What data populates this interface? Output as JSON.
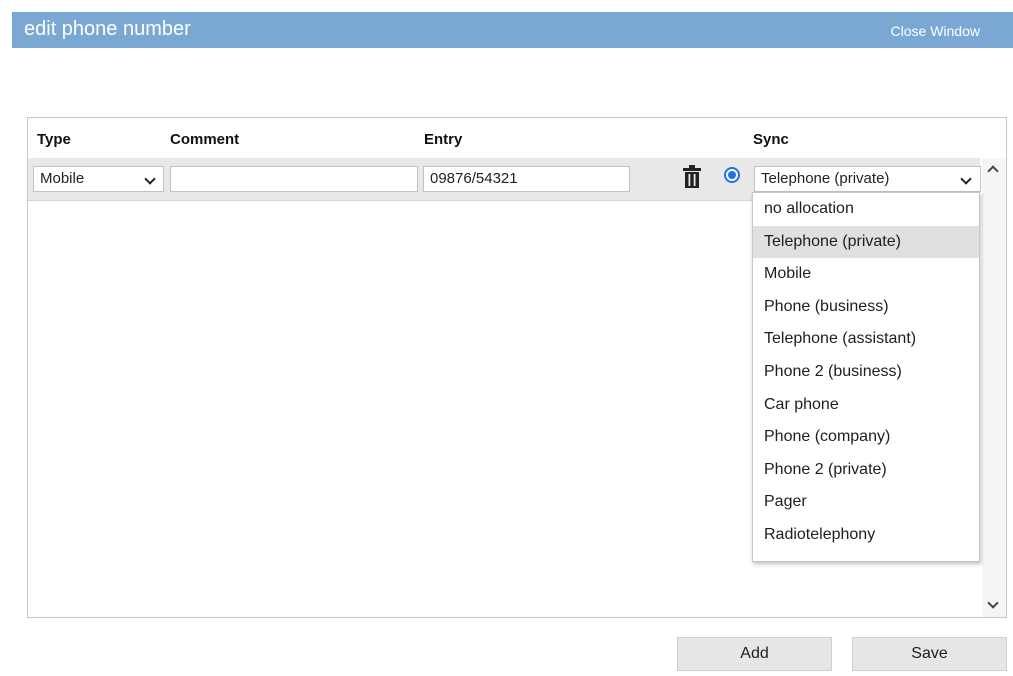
{
  "window": {
    "title": "edit phone number",
    "close_label": "Close Window"
  },
  "table": {
    "headers": {
      "type": "Type",
      "comment": "Comment",
      "entry": "Entry",
      "sync": "Sync"
    },
    "row": {
      "type_value": "Mobile",
      "comment_value": "",
      "entry_value": "09876/54321",
      "sync_value": "Telephone (private)",
      "primary_selected": true
    }
  },
  "sync_options": [
    "no allocation",
    "Telephone (private)",
    "Mobile",
    "Phone (business)",
    "Telephone (assistant)",
    "Phone 2 (business)",
    "Car phone",
    "Phone (company)",
    "Phone 2 (private)",
    "Pager",
    "Radiotelephony"
  ],
  "sync_selected_index": 1,
  "buttons": {
    "add": "Add",
    "save": "Save"
  },
  "icons": {
    "delete": "trash-icon",
    "primary": "radio-selected-icon",
    "dropdown": "chevron-down-icon",
    "scroll_up": "chevron-up-icon",
    "scroll_down": "chevron-down-icon"
  },
  "colors": {
    "titlebar": "#7ba7d3",
    "radio": "#1a73e8",
    "row_bg": "#e8e8e8",
    "selected_option": "#e0e0e0"
  }
}
